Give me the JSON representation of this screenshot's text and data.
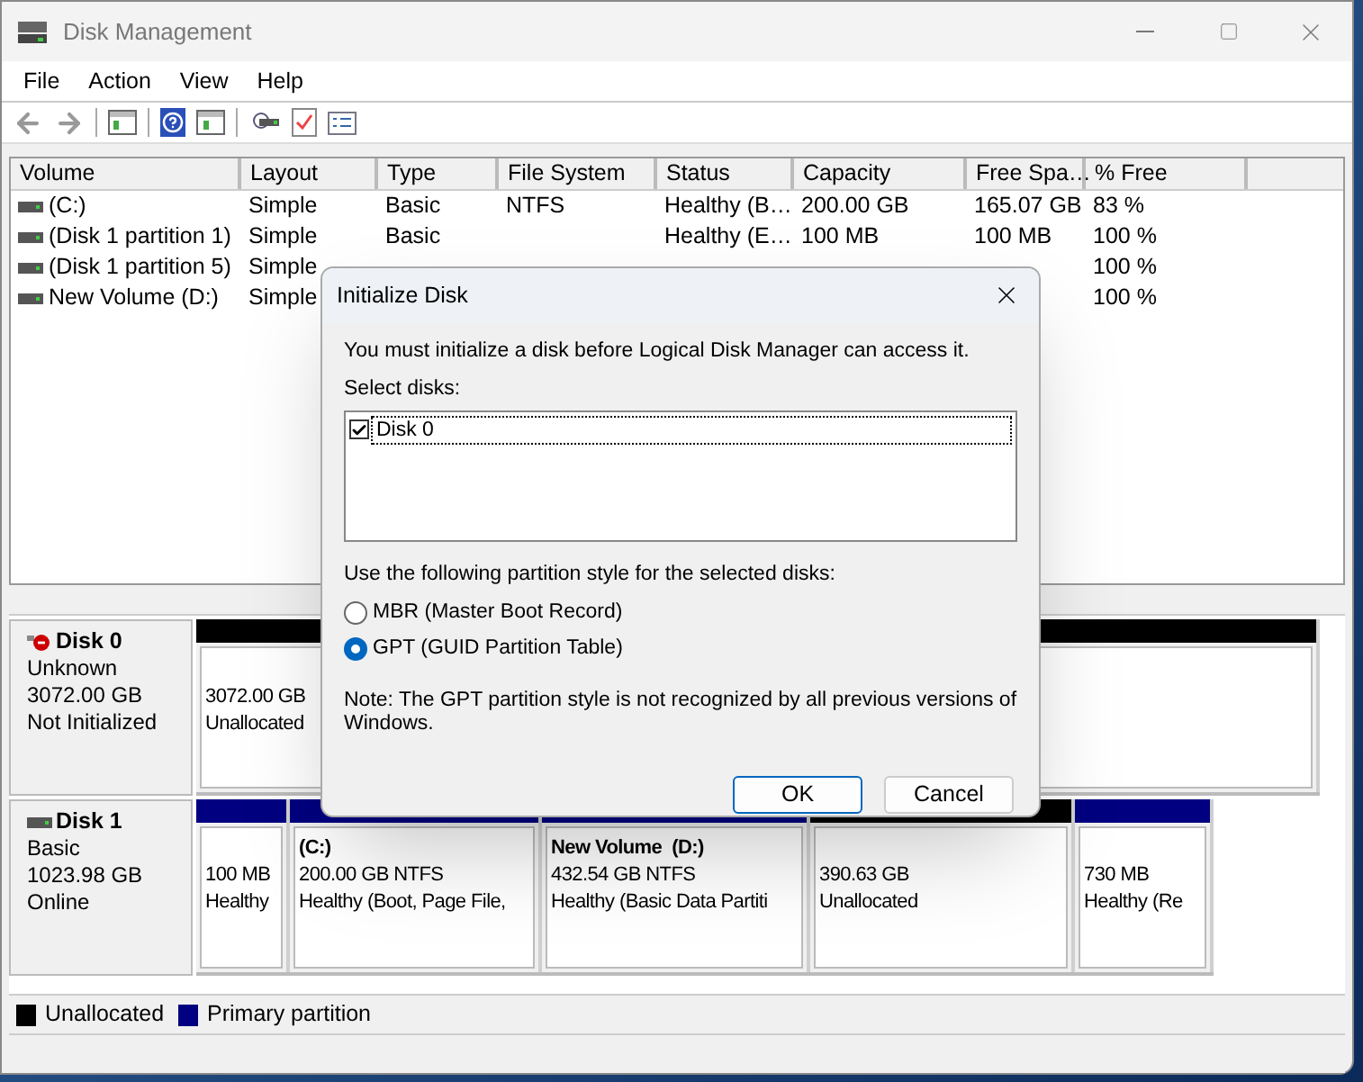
{
  "window": {
    "title": "Disk Management"
  },
  "menu": [
    {
      "label": "File"
    },
    {
      "label": "Action"
    },
    {
      "label": "View"
    },
    {
      "label": "Help"
    }
  ],
  "volume_table": {
    "columns": [
      "Volume",
      "Layout",
      "Type",
      "File System",
      "Status",
      "Capacity",
      "Free Spa…",
      "% Free"
    ],
    "rows": [
      {
        "volume": "(C:)",
        "layout": "Simple",
        "type": "Basic",
        "file_system": "NTFS",
        "status": "Healthy (B…",
        "capacity": "200.00 GB",
        "free_space": "165.07 GB",
        "percent_free": "83 %"
      },
      {
        "volume": "(Disk 1 partition 1)",
        "layout": "Simple",
        "type": "Basic",
        "status": "Healthy (E…",
        "capacity": "100 MB",
        "free_space": "100 MB",
        "percent_free": "100 %"
      },
      {
        "volume": "(Disk 1 partition 5)",
        "layout": "Simple",
        "percent_free": "100 %"
      },
      {
        "volume": "New Volume (D:)",
        "layout": "Simple",
        "percent_free": "100 %"
      }
    ]
  },
  "disks": [
    {
      "name": "Disk 0",
      "kind": "error",
      "lines": [
        "Unknown",
        "3072.00 GB",
        "Not Initialized"
      ],
      "partitions": [
        {
          "kind": "unallocated",
          "lines": [
            "3072.00 GB",
            "Unallocated"
          ]
        }
      ]
    },
    {
      "name": "Disk 1",
      "kind": "basic",
      "lines": [
        "Basic",
        "1023.98 GB",
        "Online"
      ],
      "partitions": [
        {
          "kind": "primary",
          "lines": [
            "100 MB",
            "Healthy"
          ]
        },
        {
          "kind": "primary",
          "title": "(C:)",
          "lines": [
            "200.00 GB NTFS",
            "Healthy (Boot, Page File,"
          ]
        },
        {
          "kind": "primary",
          "title": "New Volume  (D:)",
          "lines": [
            "432.54 GB NTFS",
            "Healthy (Basic Data Partiti"
          ]
        },
        {
          "kind": "unallocated",
          "lines": [
            "390.63 GB",
            "Unallocated"
          ]
        },
        {
          "kind": "primary",
          "lines": [
            "730 MB",
            "Healthy (Re"
          ]
        }
      ]
    }
  ],
  "legend": [
    {
      "label": "Unallocated",
      "color": "#000000"
    },
    {
      "label": "Primary partition",
      "color": "#000080"
    }
  ],
  "dialog": {
    "title": "Initialize Disk",
    "message": "You must initialize a disk before Logical Disk Manager can access it.",
    "select_label": "Select disks:",
    "disks": [
      {
        "label": "Disk 0",
        "checked": true,
        "selected": true
      }
    ],
    "style_label": "Use the following partition style for the selected disks:",
    "styles": [
      {
        "label": "MBR (Master Boot Record)",
        "selected": false
      },
      {
        "label": "GPT (GUID Partition Table)",
        "selected": true
      }
    ],
    "note": "Note: The GPT partition style is not recognized by all previous versions of Windows.",
    "buttons": [
      {
        "label": "OK",
        "kind": "default"
      },
      {
        "label": "Cancel",
        "kind": "normal"
      }
    ]
  }
}
